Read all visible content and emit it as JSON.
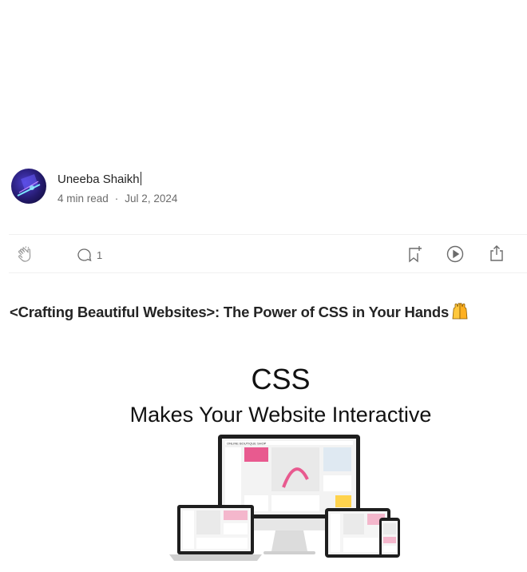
{
  "author": {
    "name": "Uneeba Shaikh",
    "read_time": "4 min read",
    "separator": "·",
    "date": "Jul 2, 2024"
  },
  "actions": {
    "clap_icon": "clap-icon",
    "response_icon": "comment-icon",
    "response_count": "1",
    "save_icon": "bookmark-add-icon",
    "listen_icon": "play-icon",
    "share_icon": "share-icon"
  },
  "article": {
    "title": "<Crafting Beautiful Websites>: The Power of CSS in Your Hands",
    "title_emoji": "raising-hands-emoji",
    "hero": {
      "heading": "CSS",
      "subheading": "Makes Your Website Interactive",
      "laptop_brand": "ONLINE BOUTIQUE SHOP"
    }
  },
  "colors": {
    "text": "#242424",
    "muted": "#6b6b6b",
    "divider": "#f0f0f0",
    "accent_pink": "#e85a8f"
  }
}
